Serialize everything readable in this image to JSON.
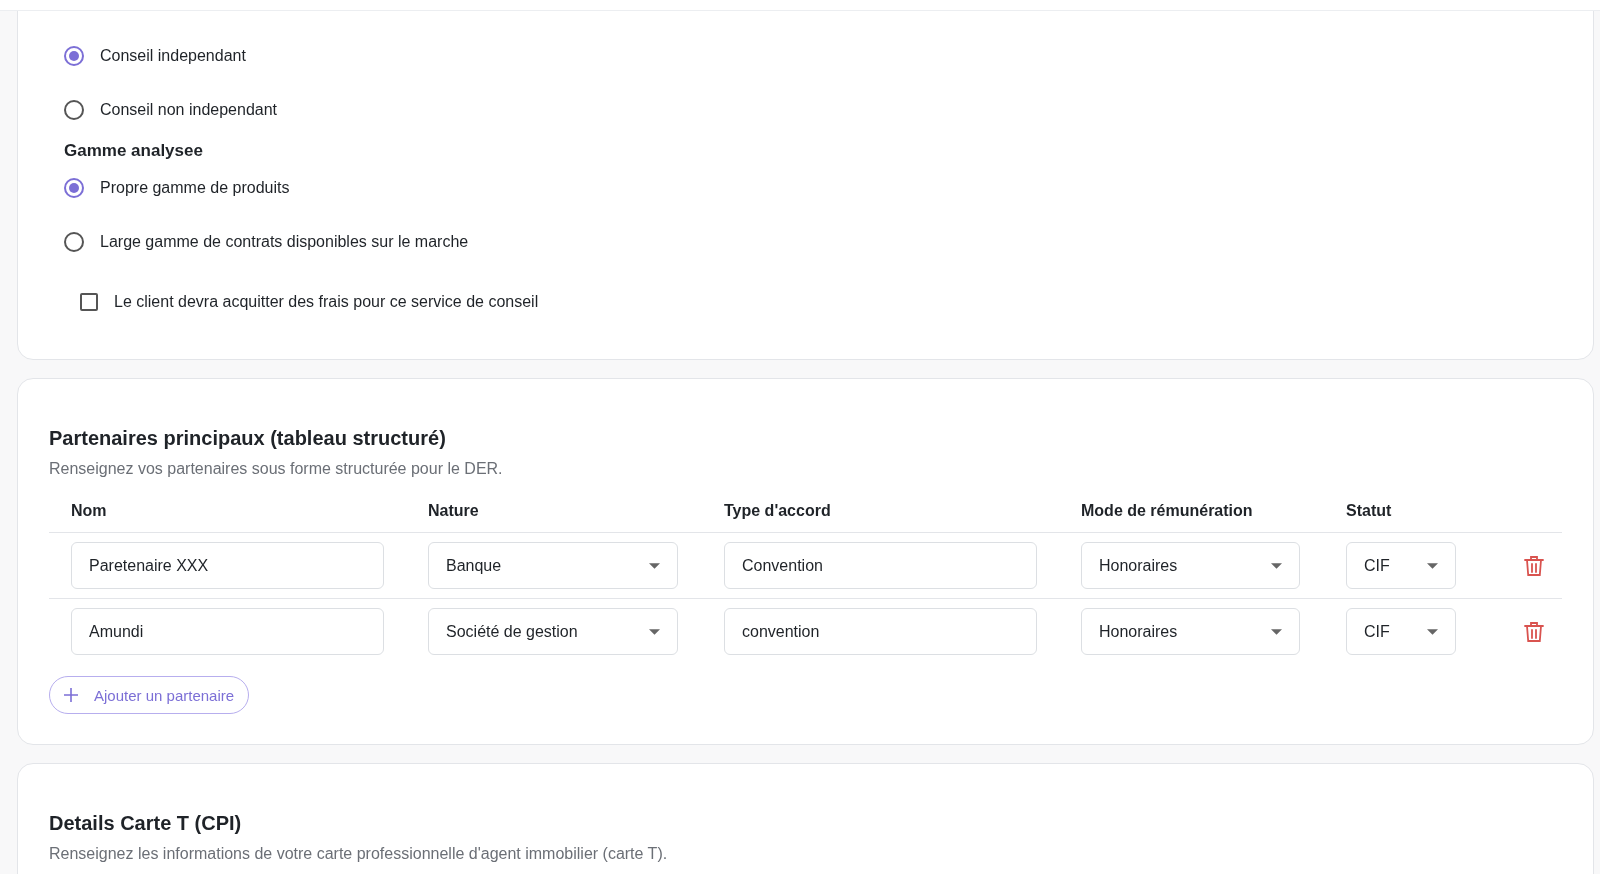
{
  "advice_type": {
    "options": [
      {
        "label": "Conseil independant",
        "selected": true
      },
      {
        "label": "Conseil non independant",
        "selected": false
      }
    ]
  },
  "range": {
    "title": "Gamme analysee",
    "options": [
      {
        "label": "Propre gamme de produits",
        "selected": true
      },
      {
        "label": "Large gamme de contrats disponibles sur le marche",
        "selected": false
      }
    ]
  },
  "fees_checkbox": {
    "label": "Le client devra acquitter des frais pour ce service de conseil",
    "checked": false
  },
  "partners": {
    "title": "Partenaires principaux (tableau structuré)",
    "subtitle": "Renseignez vos partenaires sous forme structurée pour le DER.",
    "columns": [
      "Nom",
      "Nature",
      "Type d'accord",
      "Mode de rémunération",
      "Statut"
    ],
    "rows": [
      {
        "name": "Paretenaire XXX",
        "nature": "Banque",
        "agreement": "Convention",
        "remuneration": "Honoraires",
        "status": "CIF"
      },
      {
        "name": "Amundi",
        "nature": "Société de gestion",
        "agreement": "convention",
        "remuneration": "Honoraires",
        "status": "CIF"
      }
    ],
    "add_button": "Ajouter un partenaire"
  },
  "carte_t": {
    "title": "Details Carte T (CPI)",
    "subtitle": "Renseignez les informations de votre carte professionnelle d'agent immobilier (carte T)."
  }
}
